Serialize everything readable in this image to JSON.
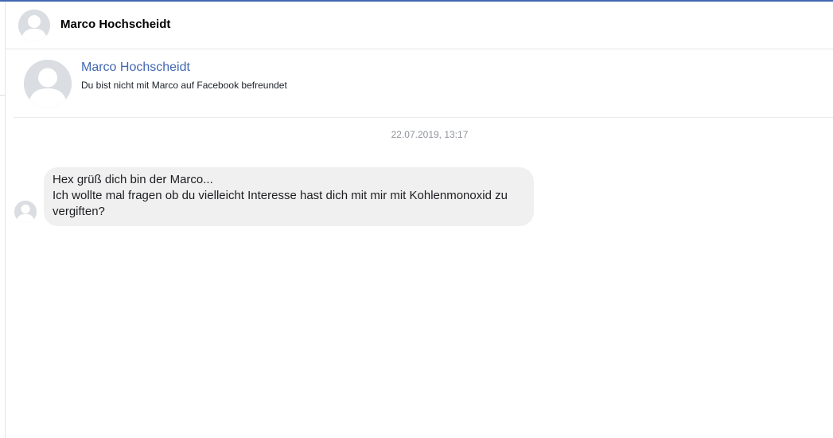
{
  "header": {
    "title": "Marco Hochscheidt"
  },
  "profile": {
    "name": "Marco Hochscheidt",
    "subtitle": "Du bist nicht mit Marco auf Facebook befreundet"
  },
  "conversation": {
    "timestamp": "22.07.2019, 13:17",
    "messages": [
      {
        "lines": [
          "Hex grüß dich bin der Marco...",
          "Ich wollte mal fragen ob du vielleicht Interesse hast dich mit mir mit Kohlenmonoxid zu vergiften?"
        ]
      }
    ]
  },
  "colors": {
    "accent": "#4267b2",
    "bubble": "#f1f0f0",
    "avatar_bg": "#dadde1",
    "avatar_fg": "#ffffff",
    "timestamp": "#90949c"
  }
}
